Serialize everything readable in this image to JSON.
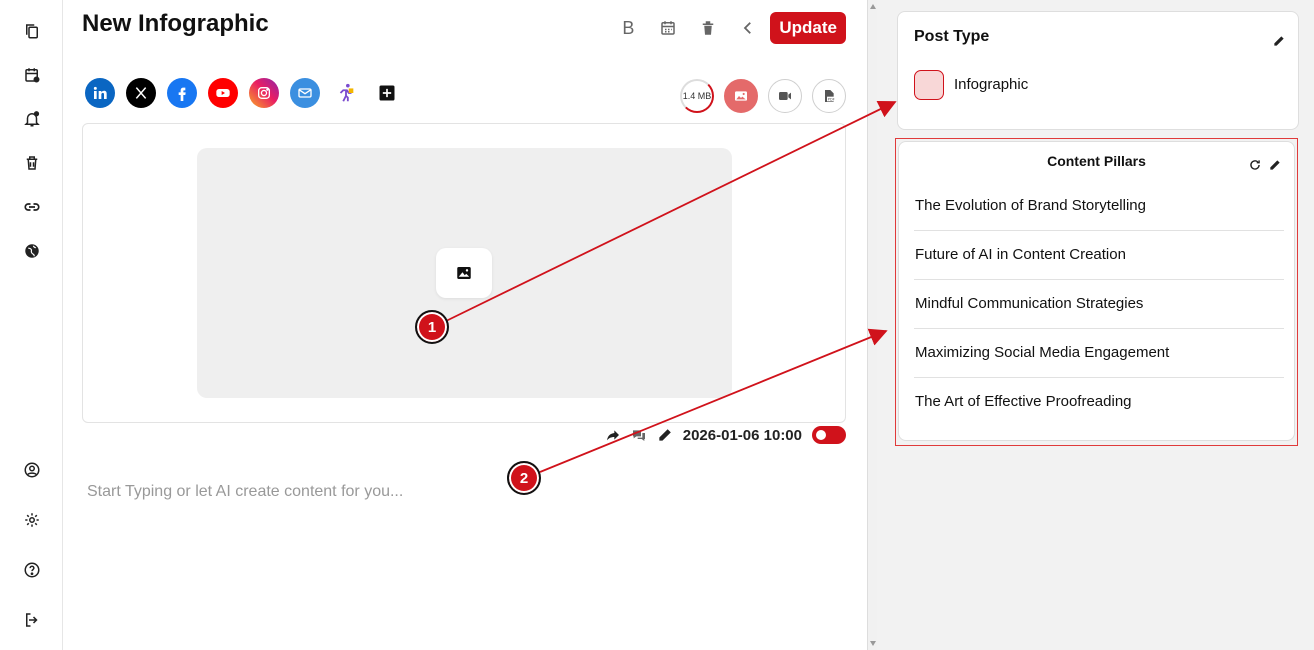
{
  "colors": {
    "accent": "#d0121b",
    "panel_bg": "#f2f2f2",
    "swatch": "#f8d7d7"
  },
  "sidebar": {
    "icons": [
      "copy-icon",
      "calendar-icon",
      "notification-icon",
      "trash-icon",
      "link-icon",
      "globe-icon"
    ],
    "bottom_icons": [
      "account-icon",
      "settings-icon",
      "help-icon",
      "logout-icon"
    ]
  },
  "header": {
    "title": "New Infographic",
    "bold_label": "B",
    "update_label": "Update"
  },
  "socials": [
    "linkedin",
    "x",
    "facebook",
    "youtube",
    "instagram",
    "email",
    "runner",
    "add"
  ],
  "media_tools": {
    "file_size": "1.4 MB"
  },
  "meta": {
    "datetime": "2026-01-06 10:00"
  },
  "editor": {
    "placeholder": "Start Typing or let AI create content for you..."
  },
  "post_type": {
    "title": "Post Type",
    "value": "Infographic"
  },
  "content_pillars": {
    "title": "Content Pillars",
    "items": [
      "The Evolution of Brand Storytelling",
      "Future of AI in Content Creation",
      "Mindful Communication Strategies",
      "Maximizing Social Media Engagement",
      "The Art of Effective Proofreading"
    ]
  },
  "annotations": {
    "badge1": "1",
    "badge2": "2"
  }
}
